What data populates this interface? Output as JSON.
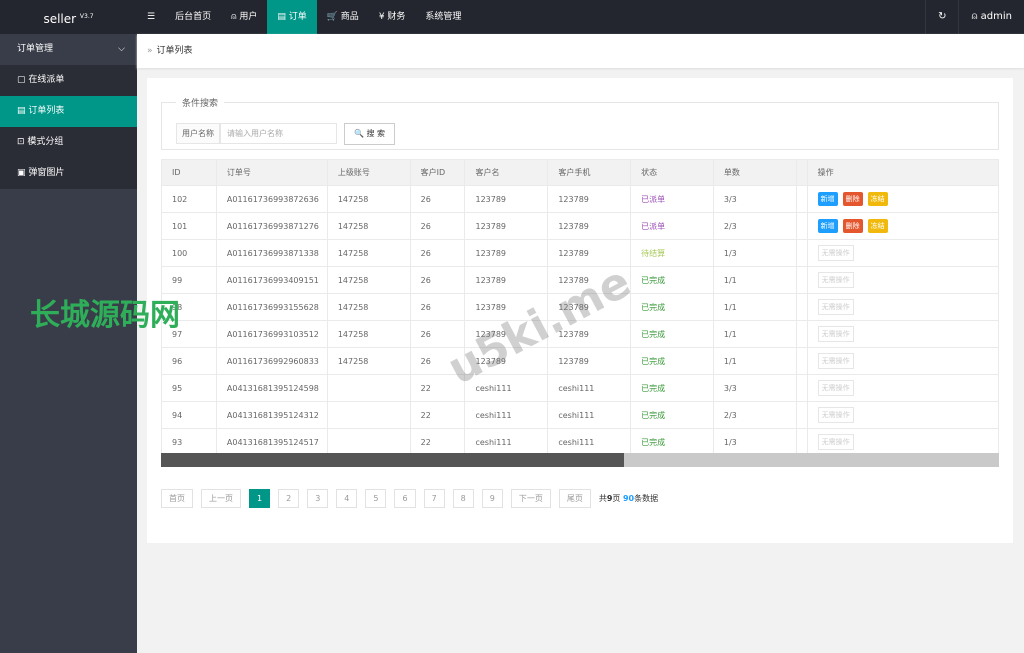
{
  "app": {
    "name": "seller",
    "version": "V3.7"
  },
  "nav": [
    {
      "label": "☰",
      "icon": "menu-icon"
    },
    {
      "label": "后台首页"
    },
    {
      "label": "⍝ 用户",
      "icon": "user-icon"
    },
    {
      "label": "▤ 订单",
      "icon": "order-icon",
      "active": true
    },
    {
      "label": "🛒 商品",
      "icon": "cart-icon"
    },
    {
      "label": "¥ 财务",
      "icon": "yen-icon"
    },
    {
      "label": "系统管理"
    }
  ],
  "right": {
    "refresh": "↻",
    "user": "⍝ admin"
  },
  "sidebar": {
    "group": "订单管理",
    "chevron": "⌵",
    "items": [
      {
        "label": "▢ 在线派单"
      },
      {
        "label": "▤ 订单列表",
        "active": true
      },
      {
        "label": "⊡ 模式分组"
      },
      {
        "label": "▣ 弹窗图片"
      }
    ]
  },
  "breadcrumb": {
    "sep": "»",
    "current": "订单列表"
  },
  "search": {
    "legend": "条件搜索",
    "label": "用户名称",
    "placeholder": "请输入用户名称",
    "button": "🔍 搜 索"
  },
  "table": {
    "headers": [
      "ID",
      "订单号",
      "上级账号",
      "客户ID",
      "客户名",
      "客户手机",
      "状态",
      "单数",
      "",
      "操作"
    ],
    "rows": [
      [
        "102",
        "A01161736993872636",
        "147258",
        "26",
        "123789",
        "123789",
        "已派单",
        "3/3"
      ],
      [
        "101",
        "A01161736993871276",
        "147258",
        "26",
        "123789",
        "123789",
        "已派单",
        "2/3"
      ],
      [
        "100",
        "A01161736993871338",
        "147258",
        "26",
        "123789",
        "123789",
        "待结算",
        "1/3"
      ],
      [
        "99",
        "A01161736993409151",
        "147258",
        "26",
        "123789",
        "123789",
        "已完成",
        "1/1"
      ],
      [
        "98",
        "A01161736993155628",
        "147258",
        "26",
        "123789",
        "123789",
        "已完成",
        "1/1"
      ],
      [
        "97",
        "A01161736993103512",
        "147258",
        "26",
        "123789",
        "123789",
        "已完成",
        "1/1"
      ],
      [
        "96",
        "A01161736992960833",
        "147258",
        "26",
        "123789",
        "123789",
        "已完成",
        "1/1"
      ],
      [
        "95",
        "A04131681395124598",
        "",
        "22",
        "ceshi111",
        "ceshi111",
        "已完成",
        "3/3"
      ],
      [
        "94",
        "A04131681395124312",
        "",
        "22",
        "ceshi111",
        "ceshi111",
        "已完成",
        "2/3"
      ],
      [
        "93",
        "A04131681395124517",
        "",
        "22",
        "ceshi111",
        "ceshi111",
        "已完成",
        "1/3"
      ]
    ],
    "actions": {
      "add": "新增",
      "delete": "删除",
      "freeze": "冻结",
      "none": "无需操作"
    },
    "status_colors": {
      "已派单": "#9c4fb5",
      "待结算": "#a7c957",
      "已完成": "#3a9a3a"
    }
  },
  "pagination": {
    "first": "首页",
    "prev": "上一页",
    "pages": [
      "1",
      "2",
      "3",
      "4",
      "5",
      "6",
      "7",
      "8",
      "9"
    ],
    "current": "1",
    "next": "下一页",
    "last": "尾页",
    "total_pages": "9",
    "total_items": "90",
    "summary_pre": "共",
    "summary_mid": "页 ",
    "summary_post": "条数据"
  },
  "watermarks": [
    "长城源码网",
    "u5ki.me"
  ],
  "colors": {
    "accent": "#009688",
    "topbar": "#23262e",
    "sidebar": "#393d49",
    "blue": "#1e9fff",
    "red": "#e4572e",
    "yellow": "#f0b90b"
  }
}
